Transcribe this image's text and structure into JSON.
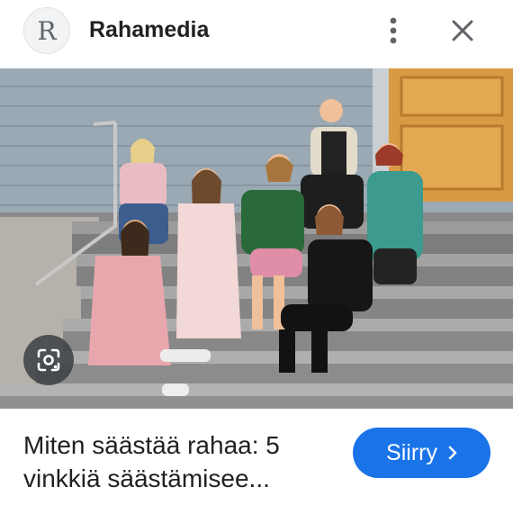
{
  "header": {
    "avatar_letter": "R",
    "site_name": "Rahamedia",
    "icons": {
      "menu": "more-vert-icon",
      "close": "close-icon"
    }
  },
  "image": {
    "lens_icon": "google-lens-icon"
  },
  "result": {
    "title_line1": "Miten säästää rahaa: 5",
    "title_line2": "vinkkiä säästämisee...",
    "visit_button": "Siirry",
    "visit_icon": "chevron-right-icon"
  },
  "colors": {
    "accent": "#1a73e8",
    "text": "#202124",
    "icon": "#5f6368"
  }
}
